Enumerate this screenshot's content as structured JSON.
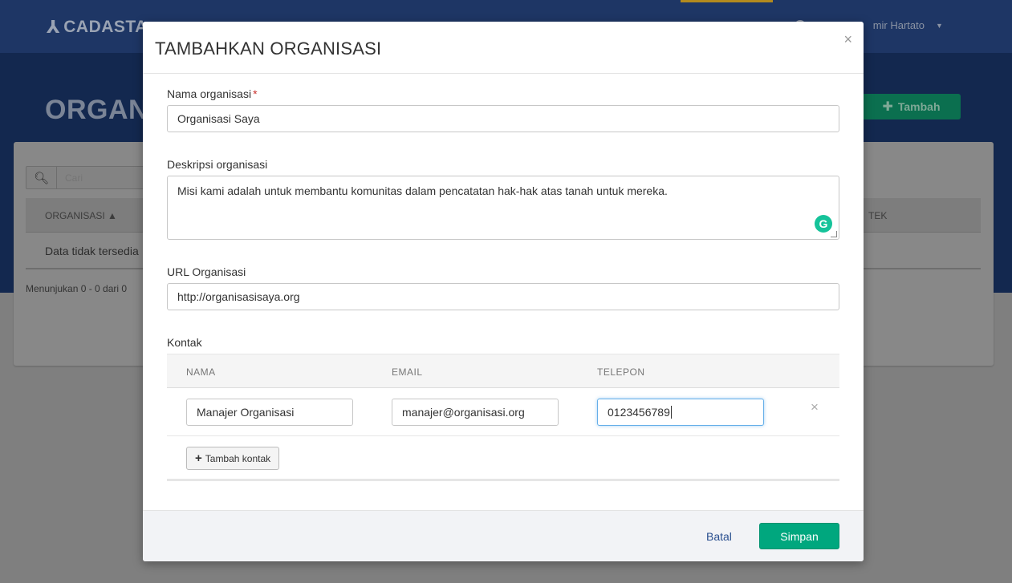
{
  "colors": {
    "nav_bg": "#1e3665",
    "hero_bg": "#13284f",
    "primary_green": "#00a77e",
    "link_blue": "#2a4f8f",
    "required_red": "#c9302c"
  },
  "nav": {
    "brand": "CADASTA",
    "brand_icon": "cadasta-logo-icon",
    "user_name": "mir Hartato"
  },
  "page": {
    "title": "ORGANIS",
    "add_button_label": "Tambah",
    "search_placeholder": "Cari",
    "table_headers": {
      "organization": "ORGANISASI ▲",
      "projects": "TEK"
    },
    "empty_message": "Data tidak tersedia",
    "pagination_info": "Menunjukan 0 - 0 dari 0"
  },
  "modal": {
    "title": "TAMBAHKAN ORGANISASI",
    "close_symbol": "×",
    "fields": {
      "name_label": "Nama organisasi",
      "required_mark": "*",
      "name_value": "Organisasi Saya",
      "description_label": "Deskripsi organisasi",
      "description_value": "Misi kami adalah untuk membantu komunitas dalam pencatatan hak-hak atas tanah untuk mereka.",
      "url_label": "URL Organisasi",
      "url_value": "http://organisasisaya.org"
    },
    "contacts": {
      "label": "Kontak",
      "headers": {
        "name": "NAMA",
        "email": "EMAIL",
        "phone": "TELEPON"
      },
      "rows": [
        {
          "name": "Manajer Organisasi",
          "email": "manajer@organisasi.org",
          "phone": "0123456789"
        }
      ],
      "remove_symbol": "×",
      "add_button_label": "Tambah kontak"
    },
    "footer": {
      "cancel_label": "Batal",
      "save_label": "Simpan"
    }
  }
}
